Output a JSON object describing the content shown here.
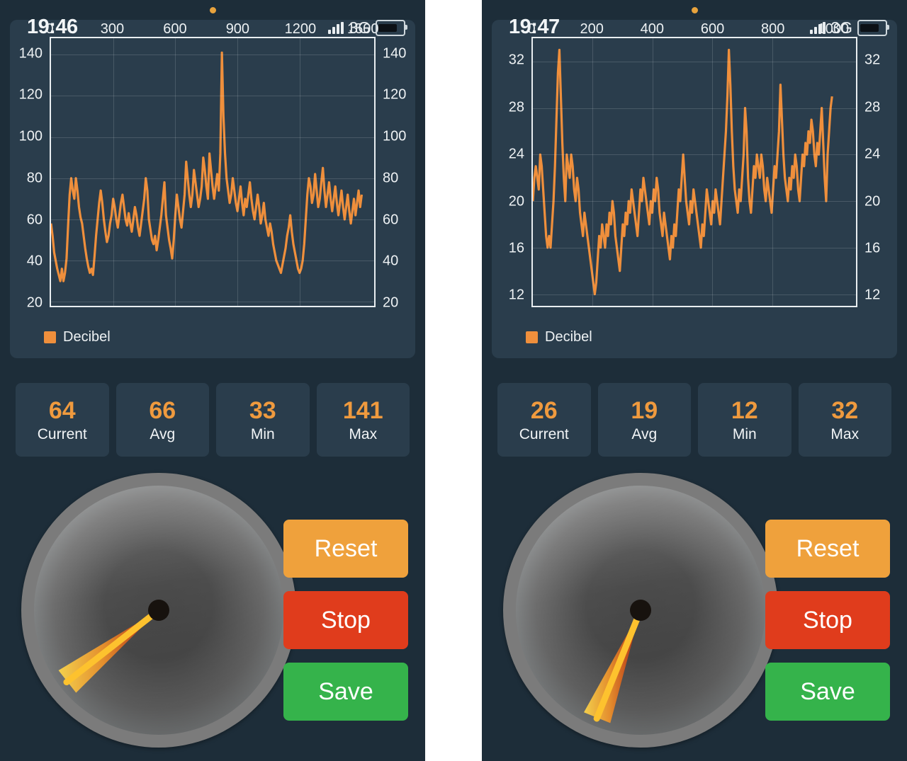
{
  "app": {
    "background": "#1d2d39",
    "card_background": "#2a3d4c",
    "accent": "#ef8f3c"
  },
  "panels": [
    {
      "id": "left",
      "status": {
        "clock": "19:46",
        "carrier": "3G",
        "signal_icon": "signal-bars-icon",
        "battery_icon": "battery-icon"
      },
      "chart": {
        "legend_label": "Decibel",
        "legend_color": "#ef8f3c"
      },
      "stats": [
        {
          "value": "64",
          "label": "Current"
        },
        {
          "value": "66",
          "label": "Avg"
        },
        {
          "value": "33",
          "label": "Min"
        },
        {
          "value": "141",
          "label": "Max"
        }
      ],
      "gauge": {
        "needle_angle_deg": 232
      },
      "buttons": [
        {
          "label": "Reset",
          "color": "#efa13c"
        },
        {
          "label": "Stop",
          "color": "#e03c1c"
        },
        {
          "label": "Save",
          "color": "#35b34b"
        }
      ],
      "chart_data": {
        "type": "line",
        "title": "",
        "xlabel": "",
        "ylabel": "",
        "series_name": "Decibel",
        "color": "#ef8f3c",
        "grid": true,
        "legend_position": "bottom-left",
        "x_ticks": [
          0,
          300,
          600,
          900,
          1200,
          1500
        ],
        "y_ticks": [
          20,
          40,
          60,
          80,
          100,
          120,
          140
        ],
        "xlim": [
          0,
          1560
        ],
        "ylim": [
          18,
          148
        ],
        "x_axis_position": "top",
        "values": [
          58,
          52,
          44,
          40,
          36,
          33,
          30,
          36,
          30,
          34,
          41,
          57,
          72,
          80,
          74,
          70,
          80,
          74,
          66,
          61,
          58,
          52,
          46,
          41,
          37,
          34,
          36,
          33,
          42,
          52,
          60,
          68,
          74,
          68,
          60,
          54,
          49,
          52,
          58,
          62,
          70,
          66,
          60,
          56,
          62,
          68,
          72,
          66,
          60,
          57,
          63,
          58,
          54,
          60,
          66,
          62,
          56,
          52,
          58,
          64,
          70,
          80,
          74,
          60,
          55,
          50,
          48,
          52,
          45,
          50,
          56,
          62,
          70,
          78,
          62,
          56,
          50,
          46,
          41,
          50,
          62,
          72,
          66,
          60,
          56,
          64,
          72,
          88,
          80,
          72,
          66,
          72,
          84,
          78,
          72,
          66,
          70,
          76,
          90,
          84,
          76,
          70,
          92,
          84,
          76,
          70,
          76,
          82,
          74,
          92,
          141,
          110,
          92,
          80,
          74,
          68,
          72,
          80,
          74,
          68,
          64,
          70,
          76,
          68,
          62,
          70,
          66,
          72,
          78,
          70,
          64,
          60,
          66,
          72,
          66,
          58,
          62,
          68,
          60,
          56,
          52,
          58,
          54,
          48,
          44,
          40,
          38,
          36,
          34,
          38,
          42,
          46,
          52,
          56,
          62,
          54,
          48,
          44,
          40,
          36,
          34,
          36,
          40,
          48,
          60,
          72,
          80,
          76,
          68,
          72,
          82,
          74,
          66,
          70,
          78,
          85,
          74,
          66,
          72,
          78,
          70,
          64,
          70,
          76,
          68,
          62,
          68,
          74,
          66,
          60,
          66,
          72,
          64,
          58,
          64,
          70,
          62,
          68,
          74,
          66,
          72
        ]
      }
    },
    {
      "id": "right",
      "status": {
        "clock": "19:47",
        "carrier": "3G",
        "signal_icon": "signal-bars-icon",
        "battery_icon": "battery-icon"
      },
      "chart": {
        "legend_label": "Decibel",
        "legend_color": "#ef8f3c"
      },
      "stats": [
        {
          "value": "26",
          "label": "Current"
        },
        {
          "value": "19",
          "label": "Avg"
        },
        {
          "value": "12",
          "label": "Min"
        },
        {
          "value": "32",
          "label": "Max"
        }
      ],
      "gauge": {
        "needle_angle_deg": 202
      },
      "buttons": [
        {
          "label": "Reset",
          "color": "#efa13c"
        },
        {
          "label": "Stop",
          "color": "#e03c1c"
        },
        {
          "label": "Save",
          "color": "#35b34b"
        }
      ],
      "chart_data": {
        "type": "line",
        "title": "",
        "xlabel": "",
        "ylabel": "",
        "series_name": "Decibel",
        "color": "#ef8f3c",
        "grid": true,
        "legend_position": "bottom-left",
        "x_ticks": [
          0,
          200,
          400,
          600,
          800,
          1000
        ],
        "y_ticks": [
          12,
          16,
          20,
          24,
          28,
          32
        ],
        "xlim": [
          0,
          1080
        ],
        "ylim": [
          11,
          34
        ],
        "x_axis_position": "top",
        "values": [
          20,
          22,
          23,
          22,
          21,
          24,
          23,
          21,
          19,
          17,
          16,
          17,
          16,
          18,
          20,
          23,
          27,
          31,
          33,
          29,
          25,
          22,
          20,
          24,
          23,
          22,
          24,
          23,
          21,
          20,
          22,
          21,
          19,
          18,
          17,
          19,
          18,
          17,
          16,
          15,
          14,
          13,
          12,
          13,
          15,
          17,
          16,
          18,
          17,
          16,
          18,
          17,
          19,
          18,
          20,
          19,
          17,
          16,
          15,
          14,
          16,
          18,
          17,
          19,
          18,
          20,
          19,
          21,
          20,
          19,
          18,
          17,
          19,
          21,
          20,
          22,
          21,
          20,
          19,
          18,
          20,
          19,
          21,
          20,
          22,
          21,
          19,
          18,
          17,
          19,
          18,
          17,
          16,
          15,
          17,
          16,
          18,
          17,
          19,
          21,
          20,
          22,
          24,
          22,
          20,
          19,
          18,
          20,
          19,
          21,
          20,
          19,
          18,
          17,
          16,
          18,
          17,
          19,
          21,
          20,
          19,
          18,
          20,
          19,
          21,
          20,
          19,
          18,
          20,
          22,
          24,
          26,
          29,
          33,
          30,
          26,
          23,
          21,
          20,
          19,
          21,
          20,
          22,
          24,
          28,
          26,
          22,
          20,
          19,
          21,
          23,
          22,
          24,
          23,
          22,
          24,
          23,
          21,
          20,
          22,
          21,
          20,
          19,
          21,
          23,
          22,
          24,
          26,
          30,
          27,
          24,
          22,
          21,
          20,
          22,
          21,
          23,
          22,
          24,
          23,
          21,
          20,
          22,
          24,
          23,
          25,
          24,
          26,
          25,
          27,
          26,
          24,
          23,
          25,
          24,
          26,
          28,
          25,
          22,
          20,
          24,
          26,
          28,
          29
        ]
      }
    }
  ]
}
